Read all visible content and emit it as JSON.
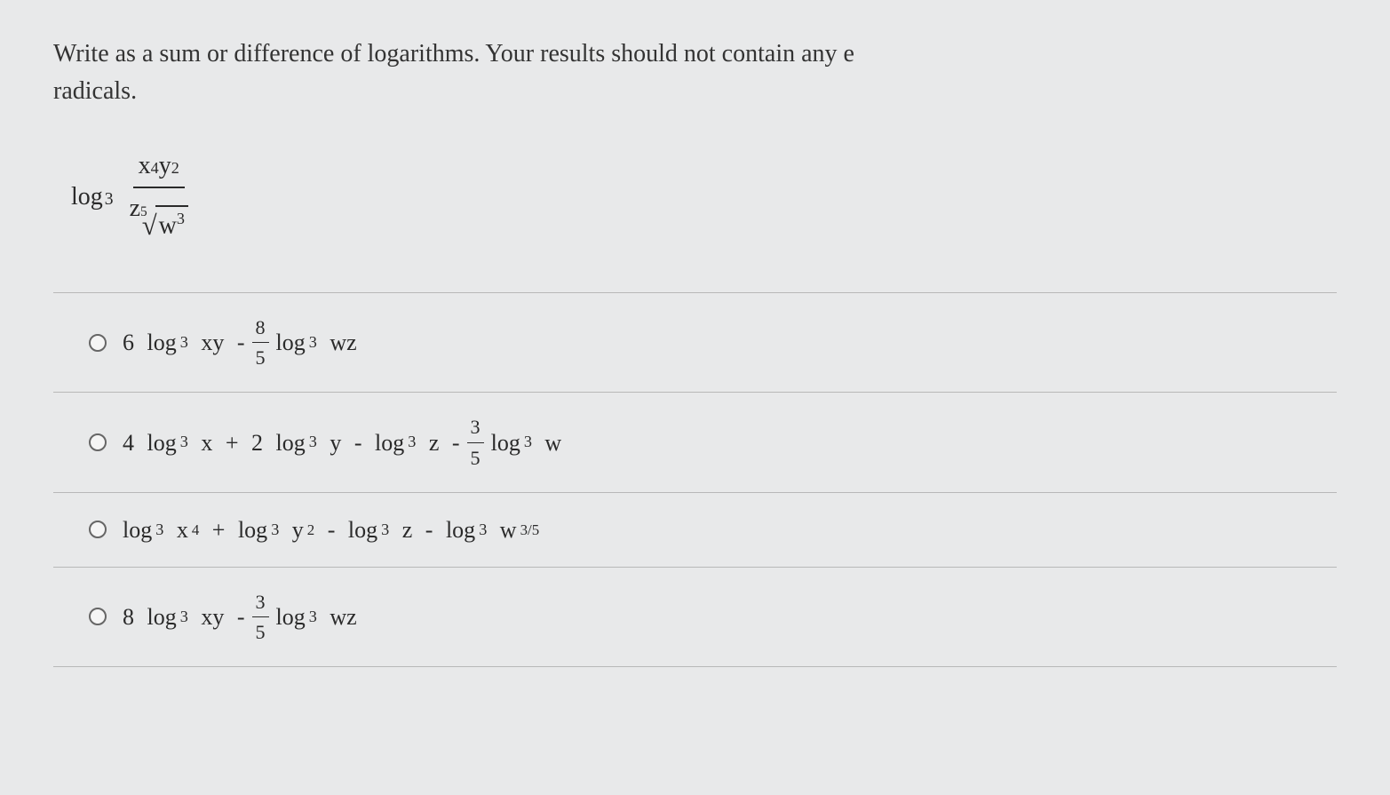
{
  "question": {
    "line1": "Write as a sum or difference of logarithms. Your results should not contain any e",
    "line2": "radicals."
  },
  "expression": {
    "log_label": "log",
    "log_base": "3",
    "numerator": {
      "var1": "x",
      "exp1": "4",
      "var2": "y",
      "exp2": "2"
    },
    "denominator": {
      "var1": "z",
      "root_index": "5",
      "root_var": "w",
      "root_exp": "3"
    }
  },
  "options": [
    {
      "parts": {
        "coef1": "6",
        "log1": "log",
        "base1": "3",
        "arg1": "xy",
        "op1": "-",
        "frac_n": "8",
        "frac_d": "5",
        "log2": "log",
        "base2": "3",
        "arg2": "wz"
      }
    },
    {
      "parts": {
        "coef1": "4",
        "log1": "log",
        "base1": "3",
        "arg1": "x",
        "op1": "+",
        "coef2": "2",
        "log2": "log",
        "base2": "3",
        "arg2": "y",
        "op2": "-",
        "log3": "log",
        "base3": "3",
        "arg3": "z",
        "op3": "-",
        "frac_n": "3",
        "frac_d": "5",
        "log4": "log",
        "base4": "3",
        "arg4": "w"
      }
    },
    {
      "parts": {
        "log1": "log",
        "base1": "3",
        "arg1": "x",
        "exp1": "4",
        "op1": "+",
        "log2": "log",
        "base2": "3",
        "arg2": "y",
        "exp2": "2",
        "op2": "-",
        "log3": "log",
        "base3": "3",
        "arg3": "z",
        "op3": "-",
        "log4": "log",
        "base4": "3",
        "arg4": "w",
        "exp4": "3/5"
      }
    },
    {
      "parts": {
        "coef1": "8",
        "log1": "log",
        "base1": "3",
        "arg1": "xy",
        "op1": "-",
        "frac_n": "3",
        "frac_d": "5",
        "log2": "log",
        "base2": "3",
        "arg2": "wz"
      }
    }
  ]
}
